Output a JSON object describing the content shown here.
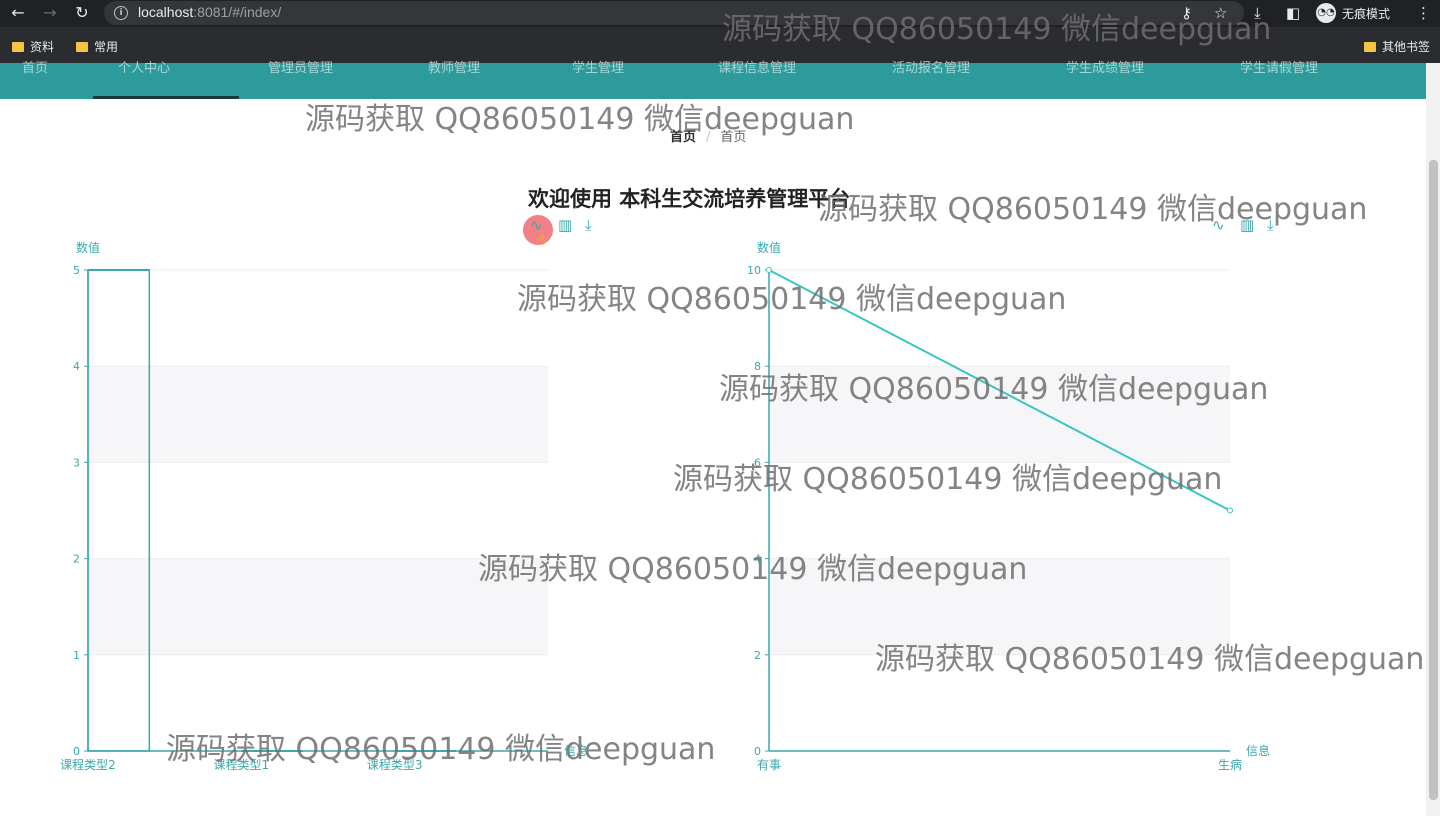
{
  "browser": {
    "url_host": "localhost",
    "url_rest": ":8081/#/index/",
    "incognito_label": "无痕模式",
    "bookmarks": [
      "资料",
      "常用"
    ],
    "other_bookmarks": "其他书签"
  },
  "nav": {
    "items": [
      "首页",
      "个人中心",
      "管理员管理",
      "教师管理",
      "学生管理",
      "课程信息管理",
      "活动报名管理",
      "学生成绩管理",
      "学生请假管理"
    ]
  },
  "breadcrumb": {
    "home": "首页",
    "current": "首页"
  },
  "welcome": "欢迎使用 本科生交流培养管理平台",
  "watermark": "源码获取 QQ86050149 微信deepguan",
  "chart_data": [
    {
      "type": "bar",
      "ylabel": "数值",
      "xlabel": "信息",
      "categories": [
        "课程类型2",
        "课程类型1",
        "课程类型3"
      ],
      "values": [
        5,
        0,
        0
      ],
      "ylim": [
        0,
        5
      ],
      "yticks": [
        0,
        1,
        2,
        3,
        4,
        5
      ],
      "color": "#39a9ad"
    },
    {
      "type": "line",
      "ylabel": "数值",
      "xlabel": "信息",
      "categories": [
        "有事",
        "生病"
      ],
      "values": [
        10,
        5
      ],
      "ylim": [
        0,
        10
      ],
      "yticks": [
        0,
        2,
        4,
        6,
        8,
        10
      ],
      "color": "#39c5c5"
    }
  ]
}
